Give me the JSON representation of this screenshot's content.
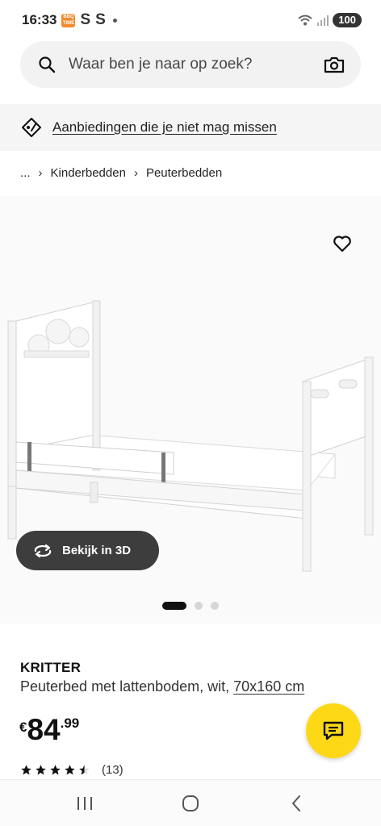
{
  "status_bar": {
    "time": "16:33",
    "notification_badge": "BBQ\nTIME",
    "notification_s1": "S",
    "notification_s2": "S",
    "battery": "100"
  },
  "search": {
    "placeholder": "Waar ben je naar op zoek?"
  },
  "promo": {
    "text": "Aanbiedingen die je niet mag missen"
  },
  "breadcrumb": {
    "ellipsis": "...",
    "items": [
      "Kinderbedden",
      "Peuterbedden"
    ]
  },
  "gallery": {
    "view_3d_label": "Bekijk in 3D",
    "current_slide": 1,
    "total_slides": 3
  },
  "product": {
    "name": "KRITTER",
    "description": "Peuterbed met lattenbodem, wit, ",
    "size": "70x160 cm",
    "price_currency": "€",
    "price_int": "84",
    "price_dec": ".99",
    "rating": 4.5,
    "rating_count": "(13)"
  },
  "colors": {
    "chat_button": "#fdd816",
    "view_3d_bg": "#3d3d3d",
    "search_bg": "#f2f2f2",
    "banner_bg": "#f5f5f5"
  },
  "icons": {
    "search": "search-icon",
    "camera": "camera-icon",
    "promo": "tag-icon",
    "favorite": "heart-icon",
    "view_3d": "rotate-icon",
    "chat": "chat-icon",
    "nav": [
      "recent-apps-icon",
      "home-icon",
      "back-icon"
    ]
  }
}
